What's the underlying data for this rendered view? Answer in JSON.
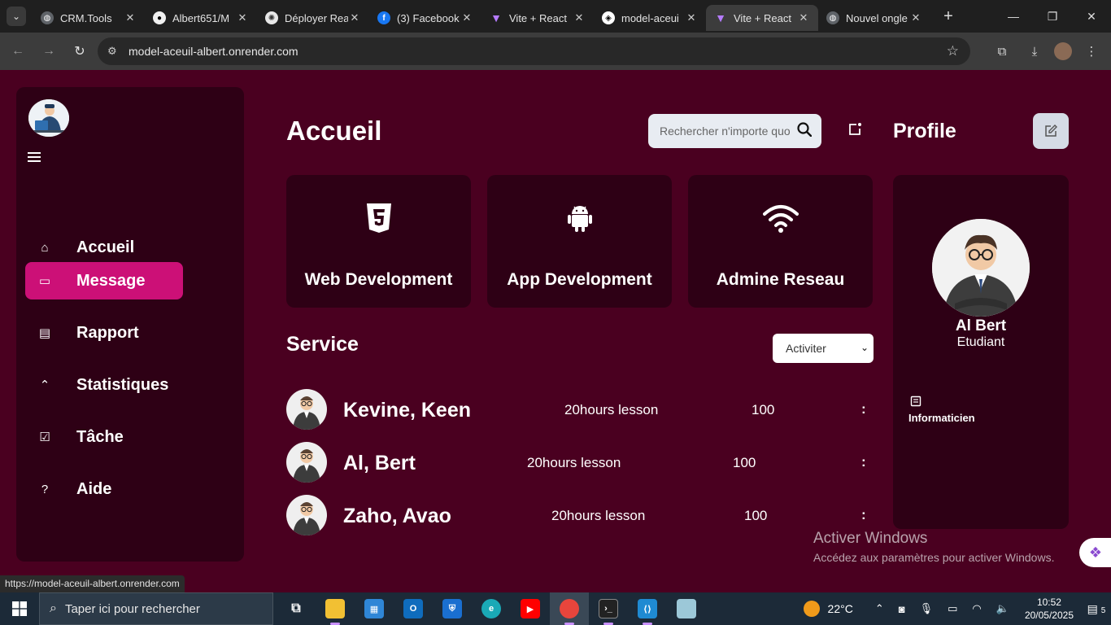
{
  "browser": {
    "tabs": [
      {
        "label": "CRM.Tools",
        "favicon": "globe-icon",
        "color": "#5f6368"
      },
      {
        "label": "Albert651/M",
        "favicon": "github-icon",
        "color": "#000000"
      },
      {
        "label": "Déployer Rea",
        "favicon": "openai-icon",
        "color": "#444444"
      },
      {
        "label": "(3) Facebook",
        "favicon": "facebook-icon",
        "color": "#1877f2"
      },
      {
        "label": "Vite + React",
        "favicon": "vite-icon",
        "color": "#8f5cff"
      },
      {
        "label": "model-aceui",
        "favicon": "render-icon",
        "color": "#ffffff"
      },
      {
        "label": "Vite + React",
        "favicon": "vite-icon",
        "color": "#8f5cff"
      },
      {
        "label": "Nouvel ongle",
        "favicon": "chrome-icon",
        "color": "#5f6368"
      }
    ],
    "active_tab": 6,
    "url": "model-aceuil-albert.onrender.com",
    "status_url": "https://model-aceuil-albert.onrender.com"
  },
  "sidebar": {
    "items": [
      {
        "label": "Accueil",
        "icon": "home-icon"
      },
      {
        "label": "Message",
        "icon": "chat-icon"
      },
      {
        "label": "Rapport",
        "icon": "report-icon"
      },
      {
        "label": "Statistiques",
        "icon": "trend-icon"
      },
      {
        "label": "Tâche",
        "icon": "clipboard-check-icon"
      },
      {
        "label": "Aide",
        "icon": "help-icon"
      }
    ],
    "active_index": 1,
    "accent_color": "#cc1077"
  },
  "header": {
    "title": "Accueil",
    "search_placeholder": "Rechercher n'importe quoi"
  },
  "cards": [
    {
      "label": "Web Development",
      "icon": "html5-icon"
    },
    {
      "label": "App Development",
      "icon": "android-icon"
    },
    {
      "label": "Admine Reseau",
      "icon": "wifi-icon"
    }
  ],
  "service": {
    "title": "Service",
    "select_value": "Activiter",
    "rows": [
      {
        "name": "Kevine, Keen",
        "lesson": "20hours lesson",
        "count": "100",
        "more": ":"
      },
      {
        "name": "Al, Bert",
        "lesson": "20hours lesson",
        "count": "100",
        "more": ":"
      },
      {
        "name": "Zaho, Avao",
        "lesson": "20hours lesson",
        "count": "100",
        "more": ":"
      }
    ]
  },
  "profile": {
    "title": "Profile",
    "name": "Al Bert",
    "role": "Etudiant",
    "info": "Informaticien"
  },
  "watermark": {
    "line1": "Activer Windows",
    "line2": "Accédez aux paramètres pour activer Windows."
  },
  "taskbar": {
    "search_placeholder": "Taper ici pour rechercher",
    "temperature": "22°C",
    "time": "10:52",
    "date": "20/05/2025",
    "notification_count": "5"
  },
  "colors": {
    "page_bg": "#4a0020",
    "panel_bg": "#2e0015",
    "accent": "#cc1077"
  }
}
